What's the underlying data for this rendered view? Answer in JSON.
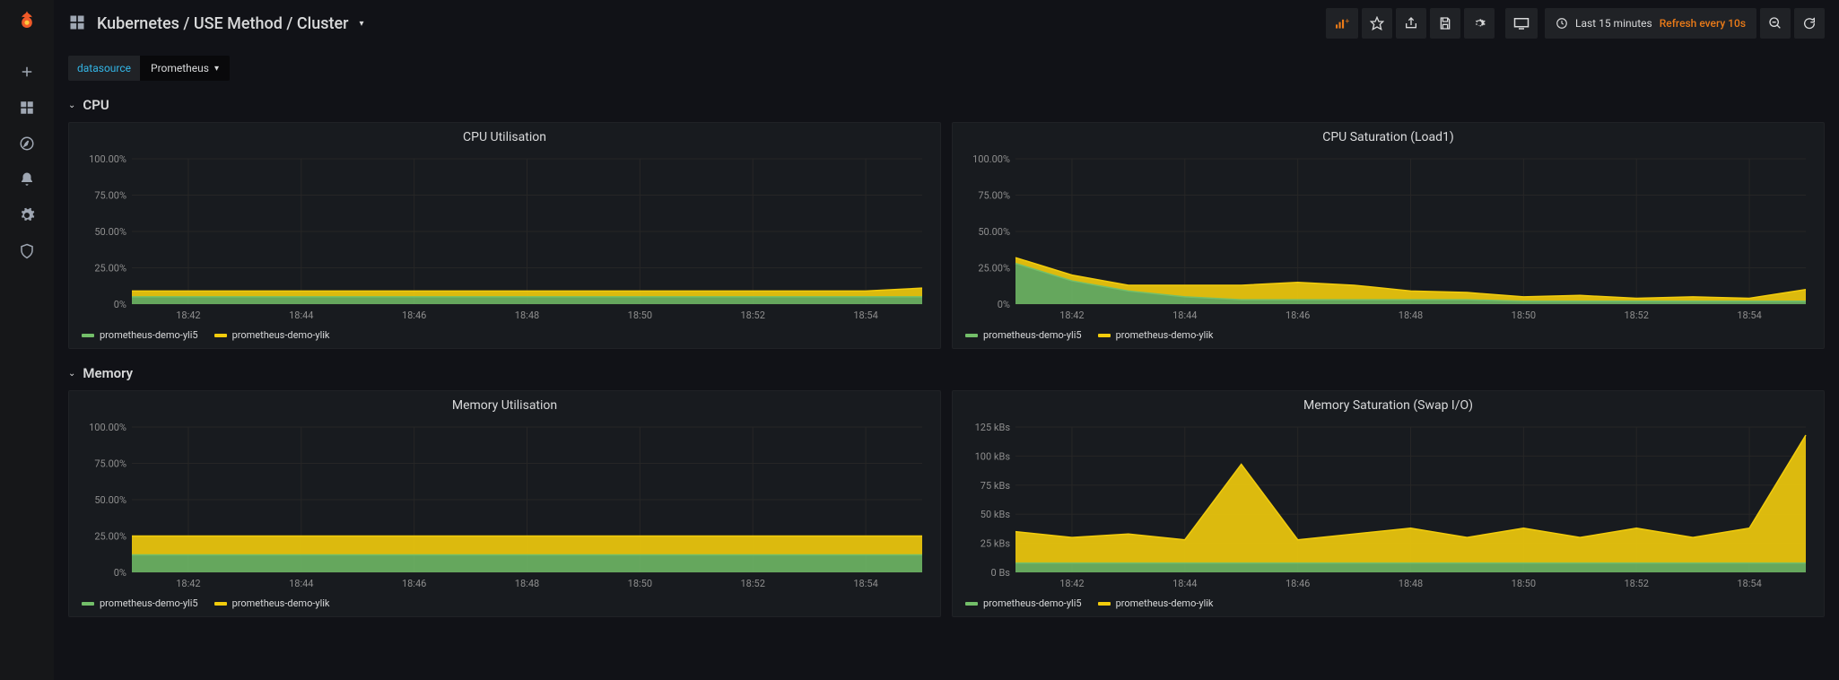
{
  "header": {
    "title": "Kubernetes / USE Method / Cluster",
    "time_range": "Last 15 minutes",
    "refresh": "Refresh every 10s"
  },
  "variables": {
    "label": "datasource",
    "value": "Prometheus"
  },
  "colors": {
    "series1": "#73bf69",
    "series2": "#f2cc0c",
    "accent": "#eb7b18"
  },
  "rows": [
    {
      "title": "CPU"
    },
    {
      "title": "Memory"
    }
  ],
  "legend_series": [
    "prometheus-demo-yli5",
    "prometheus-demo-ylik"
  ],
  "chart_data": [
    {
      "id": "cpu_util",
      "title": "CPU Utilisation",
      "type": "area",
      "x": [
        "18:42",
        "18:44",
        "18:46",
        "18:48",
        "18:50",
        "18:52",
        "18:54"
      ],
      "ylim": [
        0,
        100
      ],
      "yticks": [
        "0%",
        "25.00%",
        "50.00%",
        "75.00%",
        "100.00%"
      ],
      "yformat": "percent",
      "series": [
        {
          "name": "prometheus-demo-yli5",
          "values": [
            5,
            5,
            5,
            5,
            5,
            5,
            5,
            5,
            5,
            5,
            5,
            5,
            5,
            5,
            5
          ]
        },
        {
          "name": "prometheus-demo-ylik",
          "values": [
            4,
            4,
            4,
            4,
            4,
            4,
            4,
            4,
            4,
            4,
            4,
            4,
            4,
            4,
            6
          ]
        }
      ]
    },
    {
      "id": "cpu_sat",
      "title": "CPU Saturation (Load1)",
      "type": "area",
      "x": [
        "18:42",
        "18:44",
        "18:46",
        "18:48",
        "18:50",
        "18:52",
        "18:54"
      ],
      "ylim": [
        0,
        100
      ],
      "yticks": [
        "0%",
        "25.00%",
        "50.00%",
        "75.00%",
        "100.00%"
      ],
      "yformat": "percent",
      "series": [
        {
          "name": "prometheus-demo-yli5",
          "values": [
            28,
            16,
            9,
            5,
            3,
            3,
            3,
            3,
            3,
            2,
            2,
            2,
            2,
            2,
            2
          ]
        },
        {
          "name": "prometheus-demo-ylik",
          "values": [
            4,
            4,
            4,
            8,
            10,
            12,
            10,
            6,
            5,
            3,
            4,
            2,
            3,
            2,
            8
          ]
        }
      ]
    },
    {
      "id": "mem_util",
      "title": "Memory Utilisation",
      "type": "area",
      "x": [
        "18:42",
        "18:44",
        "18:46",
        "18:48",
        "18:50",
        "18:52",
        "18:54"
      ],
      "ylim": [
        0,
        100
      ],
      "yticks": [
        "0%",
        "25.00%",
        "50.00%",
        "75.00%",
        "100.00%"
      ],
      "yformat": "percent",
      "series": [
        {
          "name": "prometheus-demo-yli5",
          "values": [
            12,
            12,
            12,
            12,
            12,
            12,
            12,
            12,
            12,
            12,
            12,
            12,
            12,
            12,
            12
          ]
        },
        {
          "name": "prometheus-demo-ylik",
          "values": [
            13,
            13,
            13,
            13,
            13,
            13,
            13,
            13,
            13,
            13,
            13,
            13,
            13,
            13,
            13
          ]
        }
      ]
    },
    {
      "id": "mem_sat",
      "title": "Memory Saturation (Swap I/O)",
      "type": "area",
      "x": [
        "18:42",
        "18:44",
        "18:46",
        "18:48",
        "18:50",
        "18:52",
        "18:54"
      ],
      "ylim": [
        0,
        125
      ],
      "yticks": [
        "0 Bs",
        "25 kBs",
        "50 kBs",
        "75 kBs",
        "100 kBs",
        "125 kBs"
      ],
      "yformat": "bytes",
      "series": [
        {
          "name": "prometheus-demo-yli5",
          "values": [
            8,
            8,
            8,
            8,
            8,
            8,
            8,
            8,
            8,
            8,
            8,
            8,
            8,
            8,
            8
          ]
        },
        {
          "name": "prometheus-demo-ylik",
          "values": [
            27,
            22,
            25,
            20,
            85,
            20,
            25,
            30,
            22,
            30,
            22,
            30,
            22,
            30,
            110
          ]
        }
      ]
    }
  ]
}
